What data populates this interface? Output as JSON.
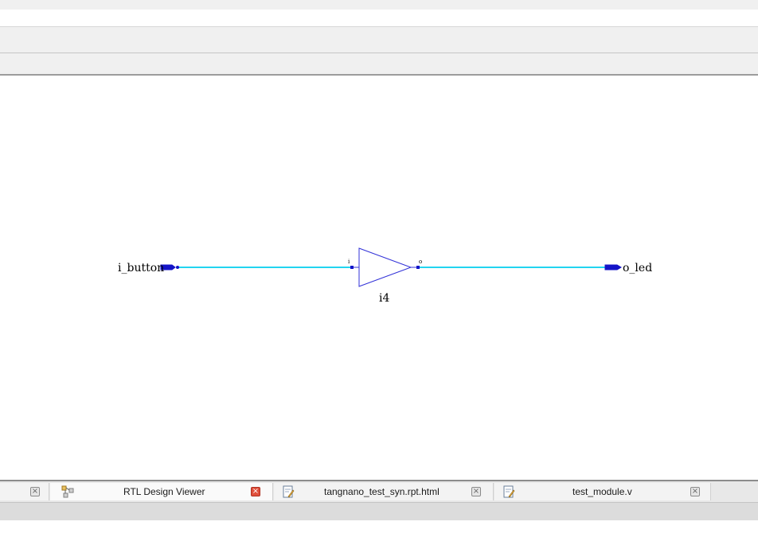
{
  "schematic": {
    "input_port": "i_button",
    "output_port": "o_led",
    "instance_name": "i4",
    "pin_in": "i",
    "pin_out": "o",
    "wire_color": "#22d4f0",
    "cell_color": "#3232d8"
  },
  "tabs": [
    {
      "label": "",
      "icon": "blank",
      "active": false
    },
    {
      "label": "RTL Design Viewer",
      "icon": "schematic-icon",
      "active": true
    },
    {
      "label": "tangnano_test_syn.rpt.html",
      "icon": "document-edit-icon",
      "active": false
    },
    {
      "label": "test_module.v",
      "icon": "document-edit-icon",
      "active": false
    }
  ],
  "close_glyph": "×"
}
